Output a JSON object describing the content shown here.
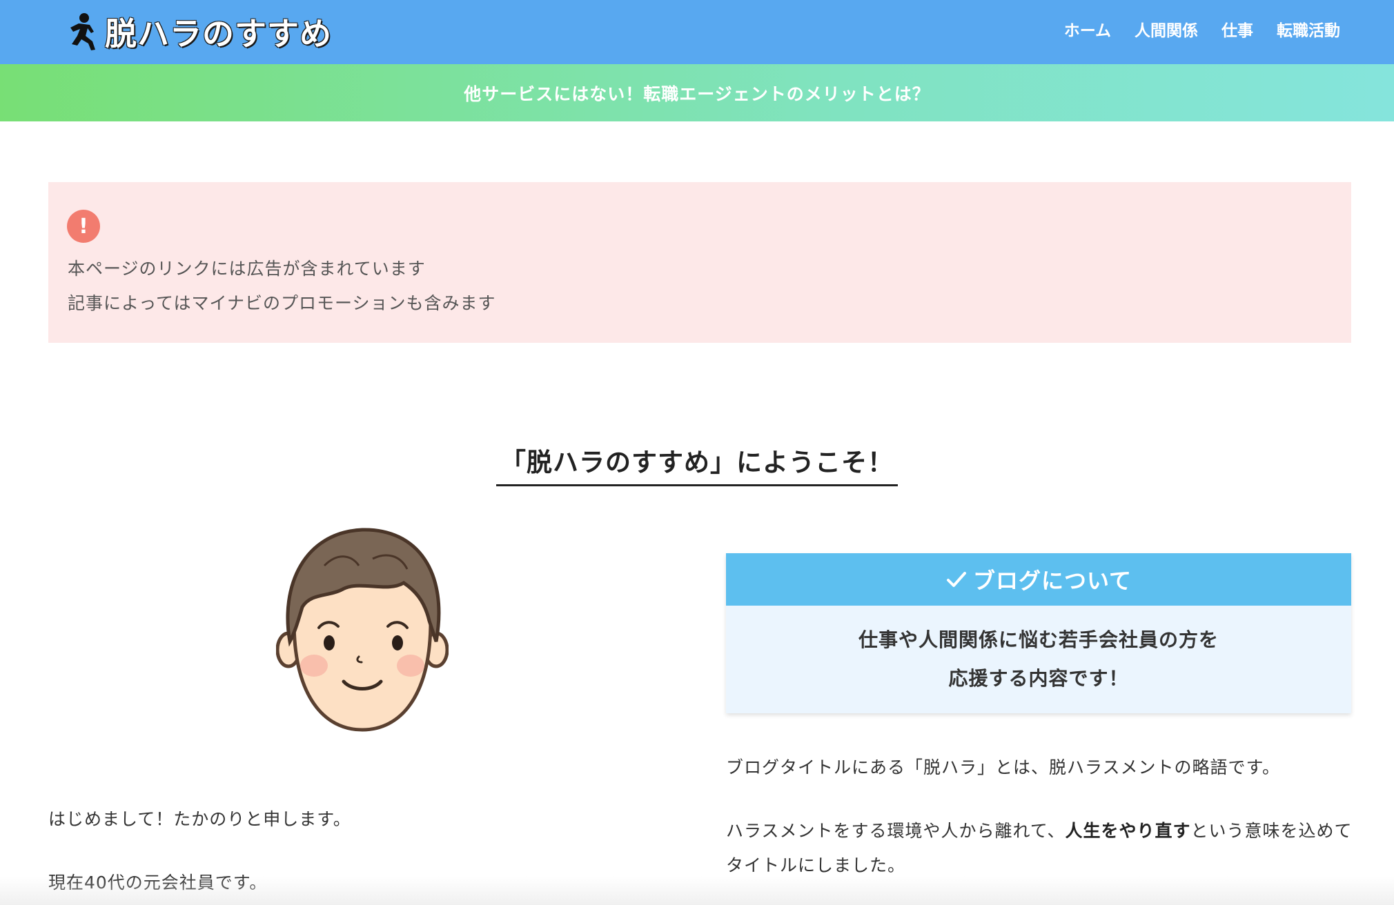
{
  "header": {
    "logo_text": "脱ハラのすすめ",
    "logo_icon": "running-man-icon",
    "nav": [
      "ホーム",
      "人間関係",
      "仕事",
      "転職活動"
    ]
  },
  "banner": {
    "text": "他サービスにはない！転職エージェントのメリットとは？"
  },
  "notice": {
    "icon": "exclamation-icon",
    "lines": [
      "本ページのリンクには広告が含まれています",
      "記事によってはマイナビのプロモーションも含みます"
    ]
  },
  "welcome": {
    "title": "「脱ハラのすすめ」にようこそ！"
  },
  "profile": {
    "avatar_icon": "smiling-man-avatar",
    "intro": "はじめまして！たかのりと申します。",
    "status": "現在40代の元会社員です。"
  },
  "about_box": {
    "heading": "ブログについて",
    "check_icon": "checkmark-icon",
    "body_line1": "仕事や人間関係に悩む若手会社員の方を",
    "body_line2": "応援する内容です！"
  },
  "about_text": {
    "p1": "ブログタイトルにある「脱ハラ」とは、脱ハラスメントの略語です。",
    "p2_before": "ハラスメントをする環境や人から離れて、",
    "p2_bold": "人生をやり直す",
    "p2_after": "という意味を込めてタイトルにしました。"
  },
  "colors": {
    "header_bg": "#58a8f0",
    "banner_gradient_start": "#78df75",
    "banner_gradient_end": "#85e4dc",
    "notice_bg": "#fde8e8",
    "notice_icon": "#f27c6f",
    "box_head": "#5dbfef",
    "box_body": "#ebf5fe"
  }
}
